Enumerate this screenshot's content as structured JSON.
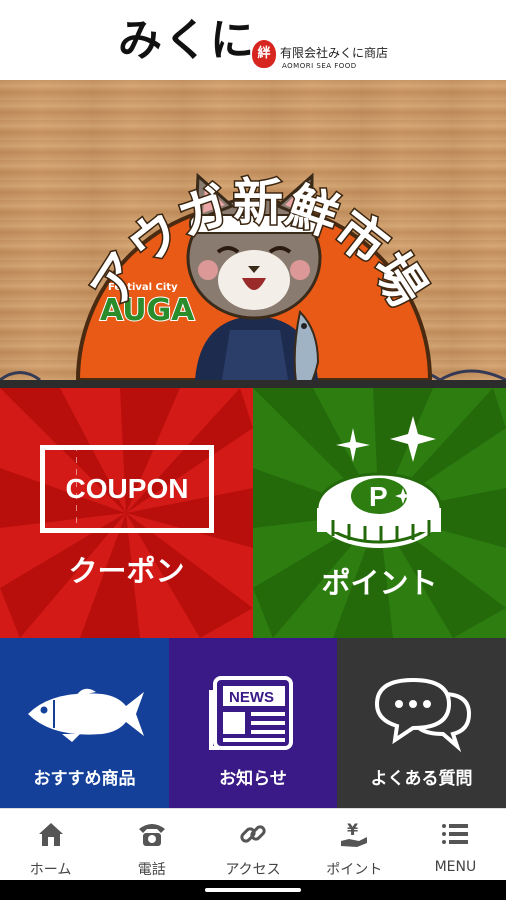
{
  "header": {
    "logo_text": "みくに",
    "seal_text": "絆",
    "company_name": "有限会社みくに商店",
    "company_sub": "AOMORI SEA FOOD"
  },
  "banner": {
    "title": "アウガ新鮮市場",
    "logo_small": "Festival City",
    "logo_main": "AUGA"
  },
  "tiles": {
    "coupon": {
      "badge": "COUPON",
      "label": "クーポン"
    },
    "point": {
      "badge": "P",
      "label": "ポイント"
    },
    "recommend": {
      "label": "おすすめ商品"
    },
    "news": {
      "badge": "NEWS",
      "label": "お知らせ"
    },
    "faq": {
      "label": "よくある質問"
    }
  },
  "bottom_nav": {
    "items": [
      {
        "label": "ホーム",
        "icon": "home-icon"
      },
      {
        "label": "電話",
        "icon": "phone-icon"
      },
      {
        "label": "アクセス",
        "icon": "link-icon"
      },
      {
        "label": "ポイント",
        "icon": "yen-hand-icon"
      },
      {
        "label": "MENU",
        "icon": "menu-icon"
      }
    ]
  },
  "colors": {
    "coupon_red": "#d41a16",
    "point_green": "#2d7d11",
    "recommend_blue": "#14409a",
    "news_purple": "#3a1a86",
    "faq_gray": "#363636",
    "banner_orange": "#e85a16"
  }
}
